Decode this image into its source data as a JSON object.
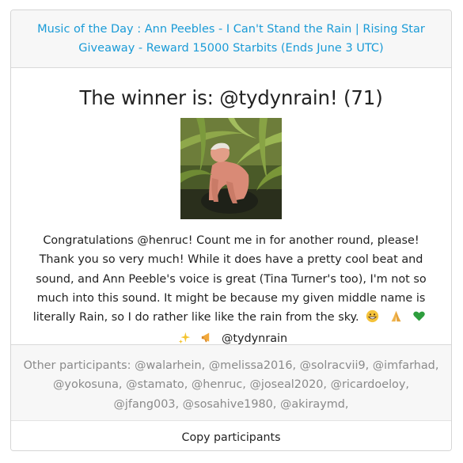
{
  "header": {
    "link_text": "Music of the Day : Ann Peebles - I Can't Stand the Rain | Rising Star Giveaway - Reward 15000 Starbits (Ends June 3 UTC)"
  },
  "winner": {
    "title": "The winner is: @tydynrain! (71)",
    "avatar_alt": "winner-avatar"
  },
  "comment": {
    "text": "Congratulations @henruc! Count me in for another round, please! Thank you so very much! While it does have a pretty cool beat and sound, and Ann Peeble's voice is great (Tina Turner's too), I'm not so much into this sound. It might be because my given middle name is literally Rain, so I do rather like like the rain from the sky.",
    "signature": "@tydynrain"
  },
  "participants": {
    "text": "Other participants: @walarhein, @melissa2016, @solracvii9, @imfarhad, @yokosuna, @stamato, @henruc, @joseal2020, @ricardoeloy, @jfang003, @sosahive1980, @akiraymd,"
  },
  "actions": {
    "copy_label": "Copy participants"
  },
  "colors": {
    "link": "#1a9bd7",
    "muted_text": "#8a8a8a",
    "panel_bg": "#f7f7f7"
  },
  "icons": [
    "grinning-face-icon",
    "folded-hands-icon",
    "green-heart-icon",
    "sparkles-icon",
    "megaphone-icon"
  ]
}
